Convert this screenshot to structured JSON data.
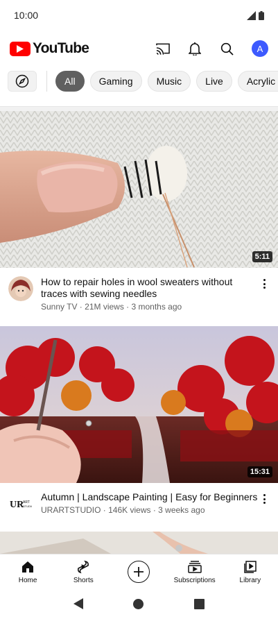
{
  "status_bar": {
    "time": "10:00"
  },
  "header": {
    "logo_text": "YouTube",
    "avatar_letter": "A"
  },
  "chips": [
    "All",
    "Gaming",
    "Music",
    "Live",
    "Acrylic pa"
  ],
  "videos": [
    {
      "title": "How to repair holes in wool sweaters without traces with sewing needles",
      "channel_line": "Sunny TV · 21M views · 3 months ago",
      "duration": "5:11"
    },
    {
      "title": "Autumn | Landscape Painting | Easy for Beginners",
      "channel_line": "URARTSTUDIO · 146K views · 3 weeks ago",
      "duration": "15:31",
      "channel_logo_text": "URART STUDIO"
    }
  ],
  "bottom_nav": {
    "home": "Home",
    "shorts": "Shorts",
    "subscriptions": "Subscriptions",
    "library": "Library"
  },
  "colors": {
    "brand_red": "#ff0000",
    "avatar_blue": "#3d5afe",
    "active_chip": "#606060"
  }
}
